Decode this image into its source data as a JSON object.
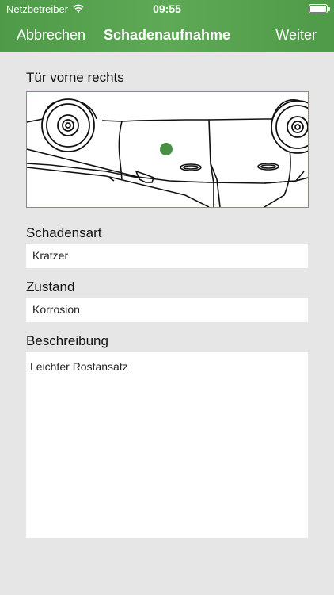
{
  "status_bar": {
    "carrier": "Netzbetreiber",
    "time": "09:55"
  },
  "nav": {
    "left_label": "Abbrechen",
    "title": "Schadenaufnahme",
    "right_label": "Weiter"
  },
  "part": {
    "label": "Tür vorne rechts",
    "marker_color": "#4a8f45"
  },
  "damage_type": {
    "label": "Schadensart",
    "value": "Kratzer"
  },
  "condition": {
    "label": "Zustand",
    "value": "Korrosion"
  },
  "description": {
    "label": "Beschreibung",
    "value": "Leichter Rostansatz"
  },
  "theme": {
    "accent": "#5ea956",
    "background": "#e6e6e6"
  }
}
